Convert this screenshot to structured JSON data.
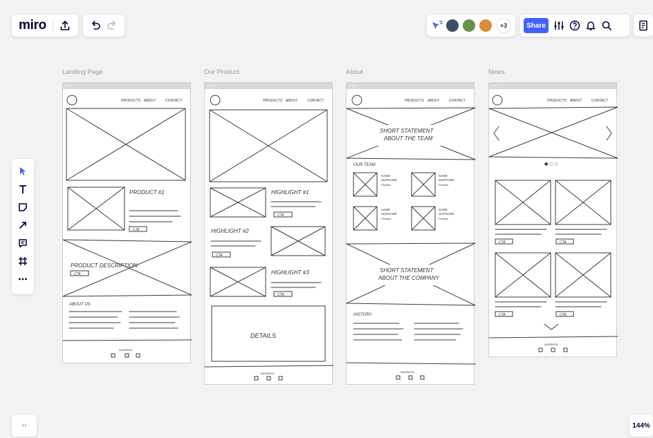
{
  "app": {
    "logo_text": "miro"
  },
  "toolbar": {
    "share_label": "Share",
    "collaborators_extra": "+3",
    "avatars": [
      {
        "name": "avatar-1",
        "color": "#3b4f66"
      },
      {
        "name": "avatar-2",
        "color": "#6b8f4e"
      },
      {
        "name": "avatar-3",
        "color": "#d98c3a"
      }
    ]
  },
  "zoom": {
    "level": "144%"
  },
  "expand_label": "››",
  "frames": [
    {
      "title": "Landing Page"
    },
    {
      "title": "Our Product"
    },
    {
      "title": "About"
    },
    {
      "title": "News"
    }
  ],
  "nav": {
    "products": "PRODUCTS",
    "about": "ABOUT",
    "contact": "CONTACT"
  },
  "landing": {
    "product": "PRODUCT #1",
    "cta": "CTA",
    "description": "PRODUCT DESCRIPTION",
    "about_us": "ABOUT US",
    "address": "ADDRESS"
  },
  "product": {
    "highlight1": "HIGHLIGHT #1",
    "highlight2": "HIGHLIGHT #2",
    "highlight3": "HIGHLIGHT #3",
    "details": "DETAILS",
    "cta": "CTA",
    "address": "ADDRESS"
  },
  "about": {
    "statement_team_1": "SHORT STATEMENT",
    "statement_team_2": "ABOUT THE TEAM",
    "our_team": "OUR TEAM",
    "member_name": "NAME",
    "member_surname": "SURNAME",
    "member_position": "Position",
    "statement_company_1": "SHORT STATEMENT",
    "statement_company_2": "ABOUT THE COMPANY",
    "history": "HISTORY",
    "address": "ADDRESS"
  },
  "news": {
    "cta": "CTA",
    "carousel_dots": "● ○ ○",
    "address": "ADDRESS"
  },
  "colors": {
    "accent": "#4262ff",
    "canvas": "#f2f2f2"
  }
}
